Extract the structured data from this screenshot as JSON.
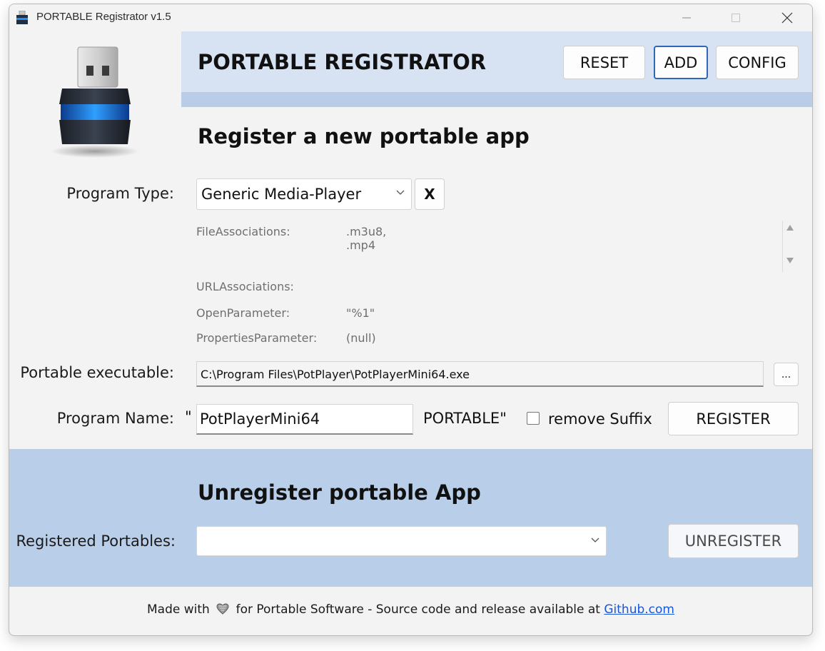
{
  "window": {
    "title": "PORTABLE Registrator v1.5",
    "controls": {
      "minimize": "minimize",
      "maximize": "maximize",
      "close": "close"
    }
  },
  "header": {
    "app_title": "PORTABLE REGISTRATOR",
    "buttons": {
      "reset": "RESET",
      "add": "ADD",
      "config": "CONFIG"
    },
    "active_button": "ADD"
  },
  "register": {
    "title": "Register a new portable app",
    "program_type_label": "Program Type:",
    "program_type_value": "Generic Media-Player",
    "clear_button": "X",
    "properties": [
      {
        "key": "FileAssociations:",
        "value": ".m3u8, .mp4"
      },
      {
        "key": "URLAssociations:",
        "value": ""
      },
      {
        "key": "OpenParameter:",
        "value": "\"%1\""
      },
      {
        "key": "PropertiesParameter:",
        "value": "(null)"
      }
    ],
    "executable_label": "Portable executable:",
    "executable_value": "C:\\Program Files\\PotPlayer\\PotPlayerMini64.exe",
    "browse_button": "...",
    "program_name_label": "Program Name:",
    "quote_open": "\"",
    "program_name_value": "PotPlayerMini64",
    "portable_suffix": "PORTABLE\"",
    "remove_suffix_label": "remove Suffix",
    "remove_suffix_checked": false,
    "register_button": "REGISTER"
  },
  "unregister": {
    "title": "Unregister portable App",
    "registered_label": "Registered Portables:",
    "registered_value": "",
    "unregister_button": "UNREGISTER"
  },
  "footer": {
    "text_before": "Made with",
    "text_after": "for Portable Software - Source code and release available at",
    "link_text": "Github.com"
  },
  "colors": {
    "header_band": "#d7e3f2",
    "unregister_panel": "#b9cfe9",
    "add_button_border": "#2f67b6",
    "link": "#1a56d8"
  },
  "icons": [
    "usb-drive-icon",
    "usb-drive-logo",
    "minimize-icon",
    "maximize-icon",
    "close-icon",
    "chevron-down-icon",
    "scroll-up-icon",
    "scroll-down-icon",
    "heart-icon"
  ]
}
